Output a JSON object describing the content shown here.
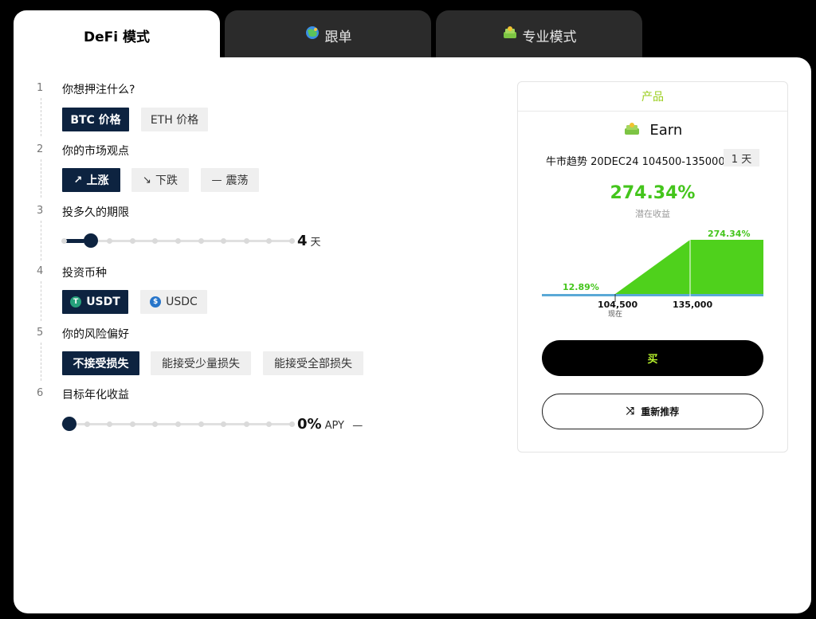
{
  "tabs": [
    {
      "label": "DeFi 模式",
      "active": true
    },
    {
      "label": "跟单",
      "icon": "globe-emoji-icon"
    },
    {
      "label": "专业模式",
      "icon": "money-emoji-icon"
    }
  ],
  "steps": [
    {
      "num": "1",
      "title": "你想押注什么?",
      "options": [
        "BTC 价格",
        "ETH 价格"
      ],
      "selected": 0
    },
    {
      "num": "2",
      "title": "你的市场观点",
      "options": [
        "上涨",
        "下跌",
        "震荡"
      ],
      "selected": 0
    },
    {
      "num": "3",
      "title": "投多久的期限",
      "slider_value": "4",
      "slider_unit": "天",
      "slider_fraction": 0.1
    },
    {
      "num": "4",
      "title": "投资币种",
      "options": [
        "USDT",
        "USDC"
      ],
      "selected": 0
    },
    {
      "num": "5",
      "title": "你的风险偏好",
      "options": [
        "不接受损失",
        "能接受少量损失",
        "能接受全部损失"
      ],
      "selected": 0
    },
    {
      "num": "6",
      "title": "目标年化收益",
      "slider_value": "0%",
      "slider_unit": "APY",
      "slider_suffix": "—",
      "slider_fraction": 0.0
    }
  ],
  "product": {
    "header": "产品",
    "title": "Earn",
    "name": "牛市趋势 20DEC24 104500-135000",
    "period": "1 天",
    "yield": "274.34%",
    "yield_label": "潜在收益",
    "chart": {
      "low_label": "12.89%",
      "high_label": "274.34%",
      "strike_low": "104,500",
      "strike_high": "135,000",
      "now_label": "现在"
    },
    "buy_label": "买",
    "refresh_label": "重新推荐"
  },
  "colors": {
    "selected": "#0d2340",
    "green": "#44c51c",
    "accent": "#b6f02c"
  }
}
